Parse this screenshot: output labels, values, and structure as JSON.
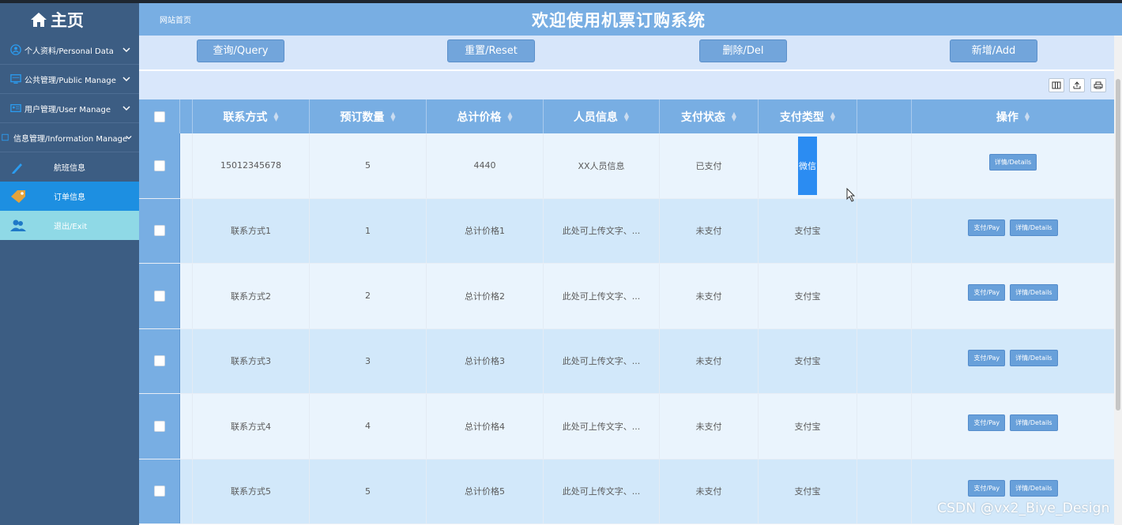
{
  "header": {
    "home_label": "主页",
    "breadcrumb": "网站首页",
    "site_title": "欢迎使用机票订购系统"
  },
  "sidebar": {
    "groups": [
      {
        "label": "个人资料/Personal Data",
        "icon": "user-circle-icon"
      },
      {
        "label": "公共管理/Public Manage",
        "icon": "monitor-icon"
      },
      {
        "label": "用户管理/User Manage",
        "icon": "id-card-icon"
      },
      {
        "label": "信息管理/Information Manage",
        "icon": "info-icon"
      }
    ],
    "items": [
      {
        "label": "航班信息",
        "icon": "pencil-icon",
        "state": "normal"
      },
      {
        "label": "订单信息",
        "icon": "tag-icon",
        "state": "active"
      },
      {
        "label": "退出/Exit",
        "icon": "users-icon",
        "state": "exit"
      }
    ]
  },
  "toolbar": {
    "query": "查询/Query",
    "reset": "重置/Reset",
    "delete": "删除/Del",
    "add": "新增/Add"
  },
  "table": {
    "columns": [
      "联系方式",
      "预订数量",
      "总计价格",
      "人员信息",
      "支付状态",
      "支付类型",
      "",
      "操作"
    ],
    "rows": [
      {
        "contact": "15012345678",
        "qty": "5",
        "price": "4440",
        "person": "XX人员信息",
        "status": "已支付",
        "type": "微信",
        "actions": [
          "详情/Details"
        ]
      },
      {
        "contact": "联系方式1",
        "qty": "1",
        "price": "总计价格1",
        "person": "此处可上传文字、...",
        "status": "未支付",
        "type": "支付宝",
        "actions": [
          "支付/Pay",
          "详情/Details"
        ]
      },
      {
        "contact": "联系方式2",
        "qty": "2",
        "price": "总计价格2",
        "person": "此处可上传文字、...",
        "status": "未支付",
        "type": "支付宝",
        "actions": [
          "支付/Pay",
          "详情/Details"
        ]
      },
      {
        "contact": "联系方式3",
        "qty": "3",
        "price": "总计价格3",
        "person": "此处可上传文字、...",
        "status": "未支付",
        "type": "支付宝",
        "actions": [
          "支付/Pay",
          "详情/Details"
        ]
      },
      {
        "contact": "联系方式4",
        "qty": "4",
        "price": "总计价格4",
        "person": "此处可上传文字、...",
        "status": "未支付",
        "type": "支付宝",
        "actions": [
          "支付/Pay",
          "详情/Details"
        ]
      },
      {
        "contact": "联系方式5",
        "qty": "5",
        "price": "总计价格5",
        "person": "此处可上传文字、...",
        "status": "未支付",
        "type": "支付宝",
        "actions": [
          "支付/Pay",
          "详情/Details"
        ]
      }
    ]
  },
  "tool_icons": [
    "columns-icon",
    "export-icon",
    "print-icon"
  ],
  "colors": {
    "sidebar_bg": "#3c5d83",
    "header_bg": "#78aee3",
    "active_item": "#1d8fe1",
    "exit_item": "#8fd9e6",
    "button_bg": "#72a5db"
  },
  "watermark": "CSDN @vx2_Biye_Design"
}
